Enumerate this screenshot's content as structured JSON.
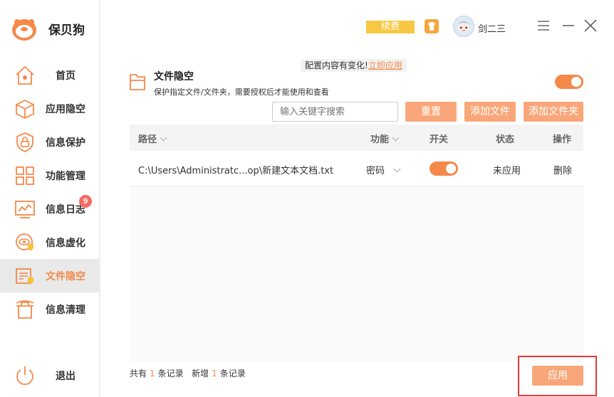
{
  "app": {
    "name": "保贝狗"
  },
  "sidebar": {
    "items": [
      {
        "label": "首页"
      },
      {
        "label": "应用隐空"
      },
      {
        "label": "信息保护"
      },
      {
        "label": "功能管理"
      },
      {
        "label": "信息日志",
        "badge": "9"
      },
      {
        "label": "信息虚化"
      },
      {
        "label": "文件隐空",
        "active": true
      },
      {
        "label": "信息清理"
      }
    ],
    "logout_label": "退出"
  },
  "header": {
    "renew_label": "续费",
    "username": "剑二三",
    "icons": [
      "tshirt-icon",
      "avatar",
      "menu-icon",
      "minimize-icon",
      "close-icon"
    ]
  },
  "notice": {
    "text": "配置内容有变化!",
    "link": "立即应用"
  },
  "feature": {
    "title": "文件隐空",
    "description": "保护指定文件/文件夹，需要授权后才能使用和查看",
    "enabled": true
  },
  "toolbar": {
    "search_placeholder": "输入关键字搜索",
    "reset_label": "重置",
    "add_file_label": "添加文件",
    "add_folder_label": "添加文件夹"
  },
  "table": {
    "columns": {
      "path": "路径",
      "function": "功能",
      "switch": "开关",
      "status": "状态",
      "action": "操作"
    },
    "rows": [
      {
        "path": "C:\\Users\\Administratc...op\\新建文本文档.txt",
        "function": "密码",
        "switch": true,
        "status": "未应用",
        "action": "删除"
      }
    ]
  },
  "footer": {
    "total_prefix": "共有",
    "total_count": "1",
    "total_suffix": "条记录",
    "new_prefix": "新增",
    "new_count": "1",
    "new_suffix": "条记录",
    "apply_label": "应用"
  },
  "colors": {
    "accent": "#f5894a",
    "button": "#f9a77a",
    "renew": "#f7c843",
    "badge": "#f36b64",
    "highlight_frame": "#e6393a"
  }
}
